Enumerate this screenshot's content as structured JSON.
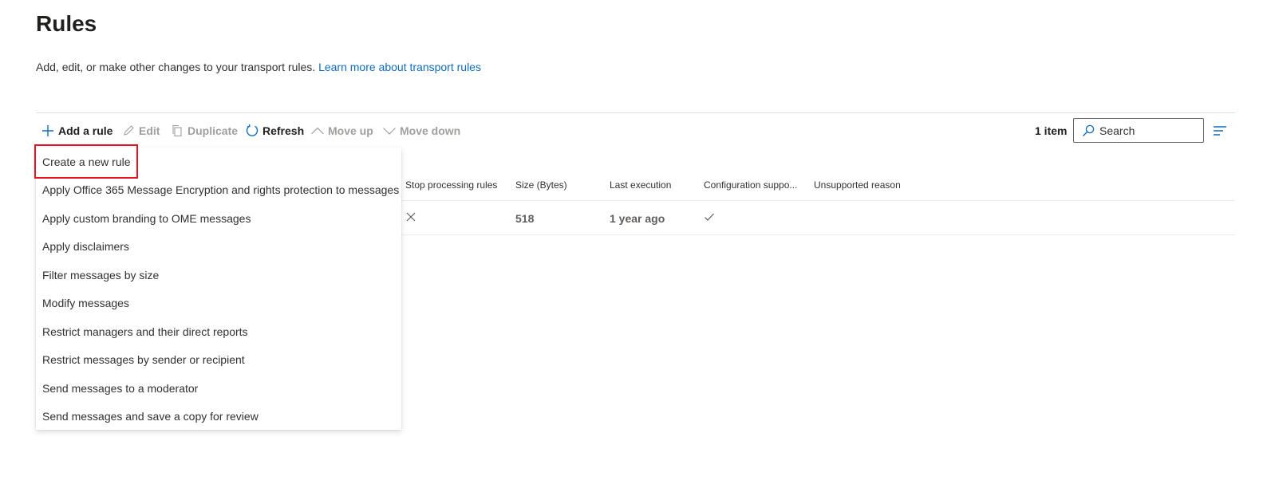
{
  "header": {
    "title": "Rules",
    "description": "Add, edit, or make other changes to your transport rules.",
    "learn_more_link": "Learn more about transport rules"
  },
  "toolbar": {
    "add_rule": "Add a rule",
    "edit": "Edit",
    "duplicate": "Duplicate",
    "refresh": "Refresh",
    "move_up": "Move up",
    "move_down": "Move down",
    "item_count": "1 item",
    "search_placeholder": "Search"
  },
  "table": {
    "columns": [
      "Stop processing rules",
      "Size (Bytes)",
      "Last execution",
      "Configuration suppo...",
      "Unsupported reason"
    ],
    "rows": [
      {
        "stop_processing_icon": "x-icon",
        "size": "518",
        "last_execution": "1 year ago",
        "configuration_supported_icon": "checkmark-icon",
        "unsupported_reason": ""
      }
    ]
  },
  "add_rule_menu": {
    "items": [
      "Create a new rule",
      "Apply Office 365 Message Encryption and rights protection to messages",
      "Apply custom branding to OME messages",
      "Apply disclaimers",
      "Filter messages by size",
      "Modify messages",
      "Restrict managers and their direct reports",
      "Restrict messages by sender or recipient",
      "Send messages to a moderator",
      "Send messages and save a copy for review"
    ],
    "highlighted_item": "Create a new rule"
  },
  "colors": {
    "accent": "#0f6cbd",
    "highlight_border": "#e5131f",
    "disabled_text": "#a19f9d"
  }
}
